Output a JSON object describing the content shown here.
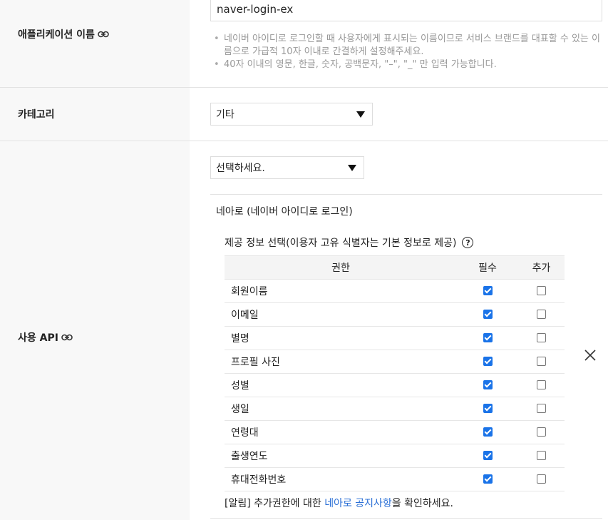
{
  "app_name_row": {
    "label": "애플리케이션 이름",
    "value": "naver-login-ex",
    "hints": [
      "네이버 아이디로 로그인할 때 사용자에게 표시되는 이름이므로 서비스 브랜드를 대표할 수 있는 이름으로 가급적 10자 이내로 간결하게 설정해주세요.",
      "40자 이내의 영문, 한글, 숫자, 공백문자, \"–\", \"_\" 만 입력 가능합니다."
    ]
  },
  "category_row": {
    "label": "카테고리",
    "selected": "기타"
  },
  "api_row": {
    "label": "사용 API",
    "select_placeholder": "선택하세요.",
    "api_title": "네아로 (네이버 아이디로 로그인)",
    "info_title": "제공 정보 선택(이용자 고유 식별자는 기본 정보로 제공)",
    "columns": [
      "권한",
      "필수",
      "추가"
    ],
    "permissions": [
      {
        "name": "회원이름",
        "required": true,
        "additional": false
      },
      {
        "name": "이메일",
        "required": true,
        "additional": false
      },
      {
        "name": "별명",
        "required": true,
        "additional": false
      },
      {
        "name": "프로필 사진",
        "required": true,
        "additional": false
      },
      {
        "name": "성별",
        "required": true,
        "additional": false
      },
      {
        "name": "생일",
        "required": true,
        "additional": false
      },
      {
        "name": "연령대",
        "required": true,
        "additional": false
      },
      {
        "name": "출생연도",
        "required": true,
        "additional": false
      },
      {
        "name": "휴대전화번호",
        "required": true,
        "additional": false
      }
    ],
    "notice_prefix": "[알림] 추가권한에 대한 ",
    "notice_link": "네아로 공지사항",
    "notice_suffix": "을 확인하세요."
  },
  "icons": {
    "link": "link-icon",
    "help": "help-icon",
    "dropdown": "caret-down-icon",
    "close": "close-icon",
    "checkbox": "checkbox-icon"
  },
  "colors": {
    "checkbox_checked": "#1a73e8",
    "link": "#2a6fd6",
    "label_bg": "#f8f8f8"
  }
}
